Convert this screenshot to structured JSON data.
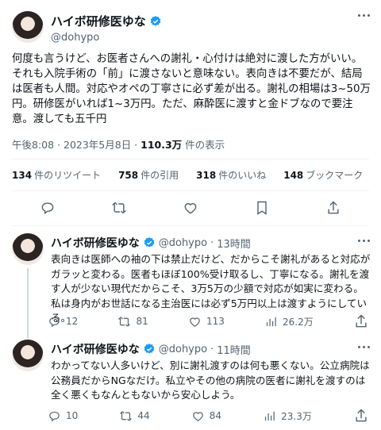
{
  "tweet": {
    "author": {
      "name": "ハイボ研修医ゆな",
      "handle": "@dohypo"
    },
    "text": "何度も言うけど、お医者さんへの謝礼・心付けは絶対に渡した方がいい。それも入院手術の「前」に渡さないと意味ない。表向きは不要だが、結局は医者も人間。対応やオペの丁寧さに必ず差が出る。謝礼の相場は3~50万円。研修医がいれば1~3万円。ただ、麻酔医に渡すと金ドブなので要注意。渡しても五千円",
    "time": "午後8:08 · 2023年5月8日 · ",
    "views_count": "110.3万",
    "views_label": " 件の表示",
    "stats": [
      {
        "count": "134",
        "label": "件のリツイート"
      },
      {
        "count": "758",
        "label": "件の引用"
      },
      {
        "count": "318",
        "label": "件のいいね"
      },
      {
        "count": "148",
        "label": "ブックマーク"
      }
    ],
    "action_icons": [
      "reply-icon",
      "retweet-icon",
      "like-icon",
      "bookmark-icon",
      "share-icon"
    ]
  },
  "replies": [
    {
      "name": "ハイボ研修医ゆな",
      "handle": "@dohypo",
      "sep": "·",
      "time": "13時間",
      "text": "表向きは医師への袖の下は禁止だけど、だからこそ謝礼があると対応がガラッと変わる。医者もほぼ100%受け取るし、丁寧になる。謝礼を渡す人が少ない現代だからこそ、3万5万の少額で対応が如実に変わる。私は身内がお世話になる主治医には必ず5万円以上は渡すようにしている。",
      "replies": "12",
      "retweets": "81",
      "likes": "113",
      "views": "26.2万"
    },
    {
      "name": "ハイボ研修医ゆな",
      "handle": "@dohypo",
      "sep": "·",
      "time": "11時間",
      "text": "わかってない人多いけど、別に謝礼渡すのは何も悪くない。公立病院は公務員だからNGなだけ。私立やその他の病院の医者に謝礼を渡すのは全く悪くもなんともないから安心しよう。",
      "replies": "10",
      "retweets": "44",
      "likes": "84",
      "views": "23.3万"
    }
  ],
  "colors": {
    "text": "#0f1419",
    "secondary": "#536471",
    "verified": "#1d9bf0",
    "divider": "#eff3f4"
  }
}
